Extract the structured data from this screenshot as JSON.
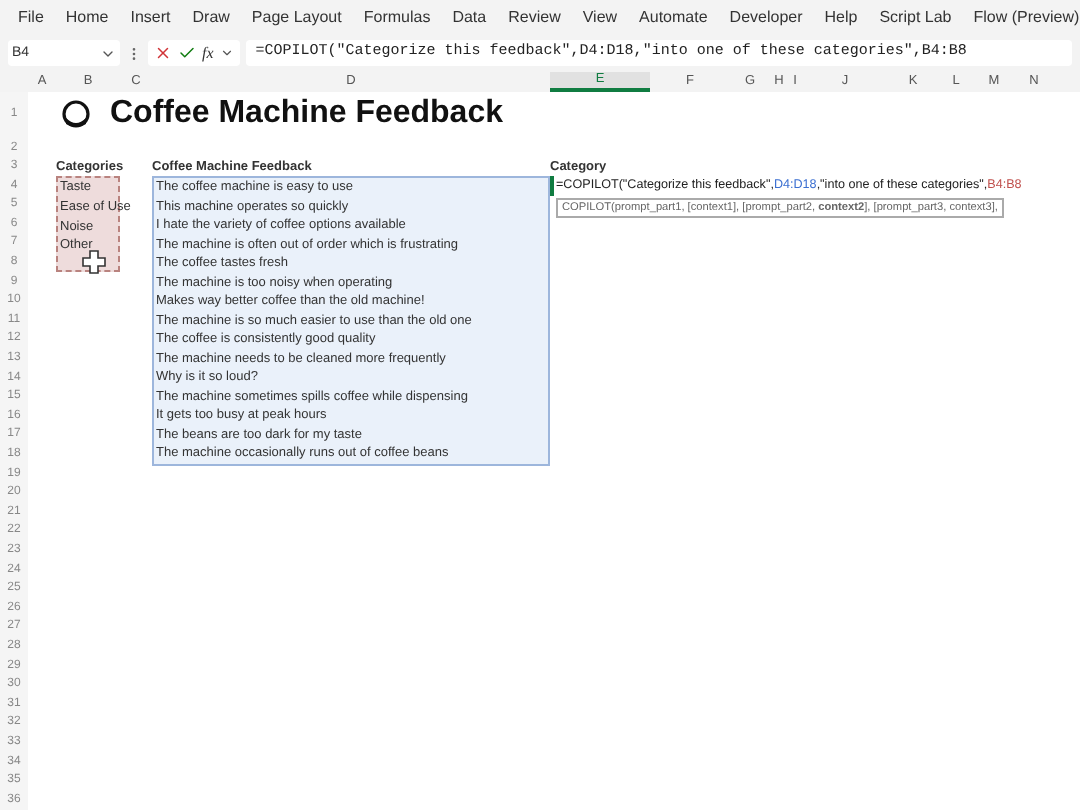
{
  "menu": [
    "File",
    "Home",
    "Insert",
    "Draw",
    "Page Layout",
    "Formulas",
    "Data",
    "Review",
    "View",
    "Automate",
    "Developer",
    "Help",
    "Script Lab",
    "Flow (Preview)"
  ],
  "formula_bar": {
    "name_box": "B4",
    "fx_label": "fx",
    "formula": "=COPILOT(\"Categorize this feedback\",D4:D18,\"into one of these categories\",B4:B8"
  },
  "columns": [
    {
      "label": "A",
      "selected": false
    },
    {
      "label": "B",
      "selected": false
    },
    {
      "label": "C",
      "selected": false
    },
    {
      "label": "D",
      "selected": false
    },
    {
      "label": "E",
      "selected": true
    },
    {
      "label": "F",
      "selected": false
    },
    {
      "label": "G",
      "selected": false
    },
    {
      "label": "H",
      "selected": false
    },
    {
      "label": "I",
      "selected": false
    },
    {
      "label": "J",
      "selected": false
    },
    {
      "label": "K",
      "selected": false
    },
    {
      "label": "L",
      "selected": false
    },
    {
      "label": "M",
      "selected": false
    },
    {
      "label": "N",
      "selected": false
    }
  ],
  "row_numbers": [
    "1",
    "2",
    "3",
    "4",
    "5",
    "6",
    "7",
    "8",
    "9",
    "10",
    "11",
    "12",
    "13",
    "14",
    "15",
    "16",
    "17",
    "18",
    "19",
    "20",
    "21",
    "22",
    "23",
    "24",
    "25",
    "26",
    "27",
    "28",
    "29",
    "30",
    "31",
    "32",
    "33",
    "34",
    "35",
    "36"
  ],
  "title": "Coffee Machine Feedback",
  "categories": {
    "header": "Categories",
    "items": [
      "Taste",
      "Ease of Use",
      "Noise",
      "Other"
    ]
  },
  "feedback": {
    "header": "Coffee Machine Feedback",
    "items": [
      "The coffee machine is easy to use",
      "This machine operates so quickly",
      "I hate the variety of coffee options available",
      "The machine is often out of order which is frustrating",
      "The coffee tastes fresh",
      "The machine is too noisy when operating",
      "Makes way better coffee than the old machine!",
      "The machine is so much easier to use than the old one",
      "The coffee is consistently good quality",
      "The machine needs to be cleaned more frequently",
      "Why is it so loud?",
      "The machine sometimes spills coffee while dispensing",
      "It gets too busy at peak hours",
      "The beans are too dark for my taste",
      "The machine occasionally runs out of coffee beans"
    ]
  },
  "category_column": {
    "header": "Category",
    "formula_parts": [
      {
        "text": "=COPILOT(\"Categorize this feedback\",",
        "color": "#222222"
      },
      {
        "text": "D4:D18",
        "color": "#3b6fd1"
      },
      {
        "text": ",\"into one of these categories\",",
        "color": "#222222"
      },
      {
        "text": "B4:B8",
        "color": "#c0504d"
      }
    ],
    "tooltip": "COPILOT(prompt_part1, [context1], [prompt_part2, **context2**], [prompt_part3, context3],"
  }
}
